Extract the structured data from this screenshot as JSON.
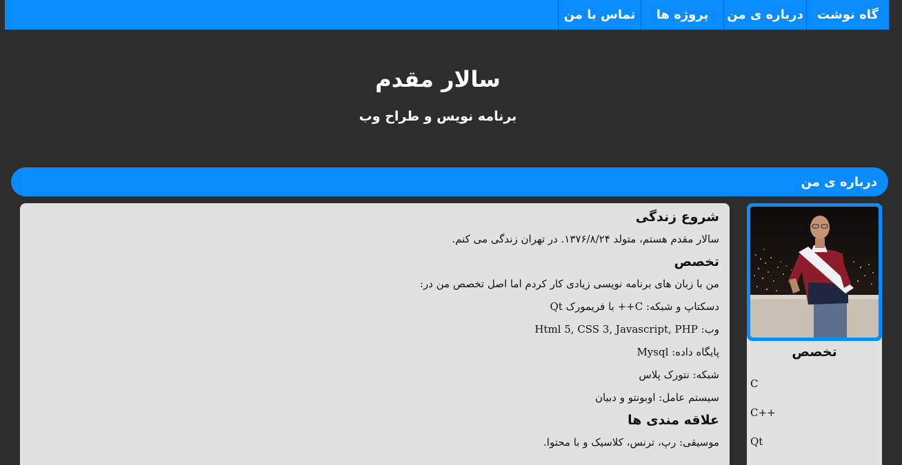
{
  "nav": {
    "items": [
      {
        "label": "گاه نوشت"
      },
      {
        "label": "درباره ی من"
      },
      {
        "label": "پروژه ها"
      },
      {
        "label": "تماس با من"
      }
    ]
  },
  "hero": {
    "title": "سالار مقدم",
    "subtitle": "برنامه نویس و طراح وب"
  },
  "section": {
    "title": "درباره ی من"
  },
  "content": {
    "heading_life": "شروع زندگی",
    "life_text": "سالار مقدم هستم، متولد ۱۳۷۶/۸/۲۴. در تهران زندگی می کنم.",
    "heading_expertise": "تخصص",
    "expertise_intro": "من با زبان های برنامه نویسی زیادی کار کردم اما اصل تخصص من در:",
    "expertise_desktop": "دسکتاپ و شبکه: C++ با فریمورک Qt",
    "expertise_web": "وب: Html 5, CSS 3, Javascript, PHP",
    "expertise_db": "پایگاه داده: Mysql",
    "expertise_network": "شبکه: نتورک پلاس",
    "expertise_os": "سیستم عامل: اوبونتو و دبیان",
    "heading_interests": "علاقه مندی ها",
    "interests_music": "موسیقی: رپ، ترنس، کلاسیک و با محتوا."
  },
  "sidebar": {
    "title": "تخصص",
    "skills": [
      "C",
      "C++",
      "Qt"
    ]
  },
  "colors": {
    "accent": "#0a8cff",
    "background": "#2d2d2d",
    "panel": "#e1e1e1"
  }
}
